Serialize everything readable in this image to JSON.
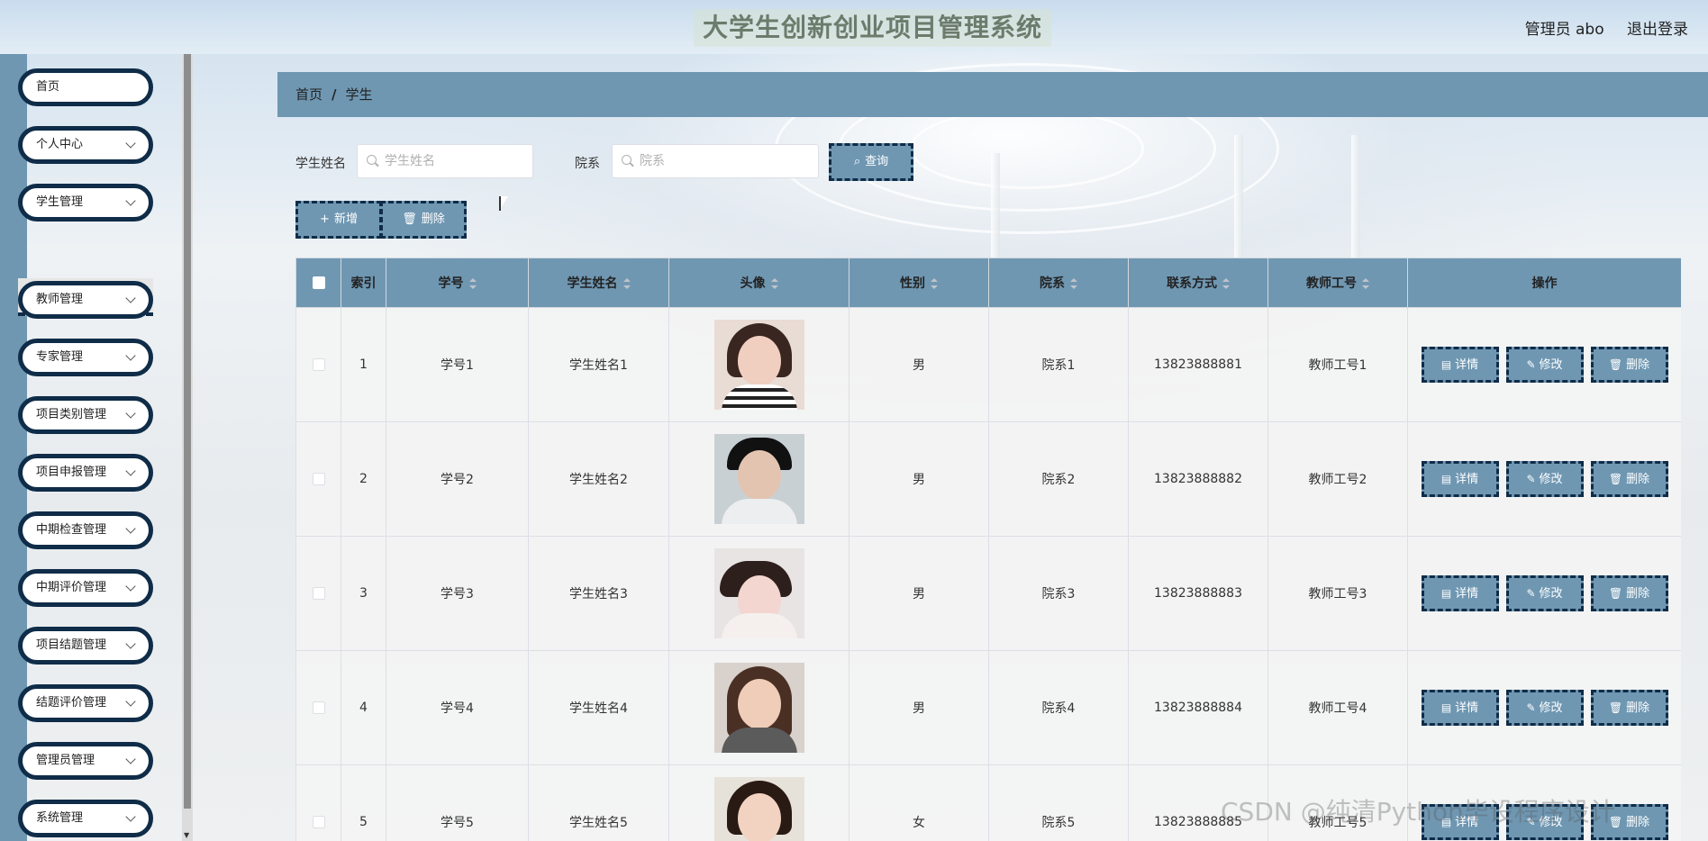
{
  "header": {
    "title": "大学生创新创业项目管理系统",
    "user": "管理员 abo",
    "logout": "退出登录"
  },
  "sidebar": {
    "items": [
      {
        "label": "首页",
        "has_arrow": false
      },
      {
        "label": "个人中心",
        "has_arrow": true
      },
      {
        "label": "学生管理",
        "has_arrow": true
      },
      {
        "label": "教师管理",
        "has_arrow": true
      },
      {
        "label": "专家管理",
        "has_arrow": true
      },
      {
        "label": "项目类别管理",
        "has_arrow": true
      },
      {
        "label": "项目申报管理",
        "has_arrow": true
      },
      {
        "label": "中期检查管理",
        "has_arrow": true
      },
      {
        "label": "中期评价管理",
        "has_arrow": true
      },
      {
        "label": "项目结题管理",
        "has_arrow": true
      },
      {
        "label": "结题评价管理",
        "has_arrow": true
      },
      {
        "label": "管理员管理",
        "has_arrow": true
      },
      {
        "label": "系统管理",
        "has_arrow": true
      }
    ],
    "active_sub": "学生"
  },
  "breadcrumb": {
    "home": "首页",
    "sep": "/",
    "current": "学生"
  },
  "search": {
    "name_label": "学生姓名",
    "name_placeholder": "学生姓名",
    "dept_label": "院系",
    "dept_placeholder": "院系",
    "query_button": "查询"
  },
  "actions": {
    "add": "新增",
    "delete": "删除"
  },
  "table": {
    "headers": [
      "索引",
      "学号",
      "学生姓名",
      "头像",
      "性别",
      "院系",
      "联系方式",
      "教师工号",
      "操作"
    ],
    "rows": [
      {
        "index": "1",
        "id": "学号1",
        "name": "学生姓名1",
        "gender": "男",
        "dept": "院系1",
        "phone": "13823888881",
        "teacher": "教师工号1"
      },
      {
        "index": "2",
        "id": "学号2",
        "name": "学生姓名2",
        "gender": "男",
        "dept": "院系2",
        "phone": "13823888882",
        "teacher": "教师工号2"
      },
      {
        "index": "3",
        "id": "学号3",
        "name": "学生姓名3",
        "gender": "男",
        "dept": "院系3",
        "phone": "13823888883",
        "teacher": "教师工号3"
      },
      {
        "index": "4",
        "id": "学号4",
        "name": "学生姓名4",
        "gender": "男",
        "dept": "院系4",
        "phone": "13823888884",
        "teacher": "教师工号4"
      },
      {
        "index": "5",
        "id": "学号5",
        "name": "学生姓名5",
        "gender": "女",
        "dept": "院系5",
        "phone": "13823888885",
        "teacher": "教师工号5"
      }
    ],
    "row_ops": {
      "detail": "详情",
      "edit": "修改",
      "delete": "删除"
    }
  },
  "watermark": "CSDN @纯清Python毕设程序设计"
}
